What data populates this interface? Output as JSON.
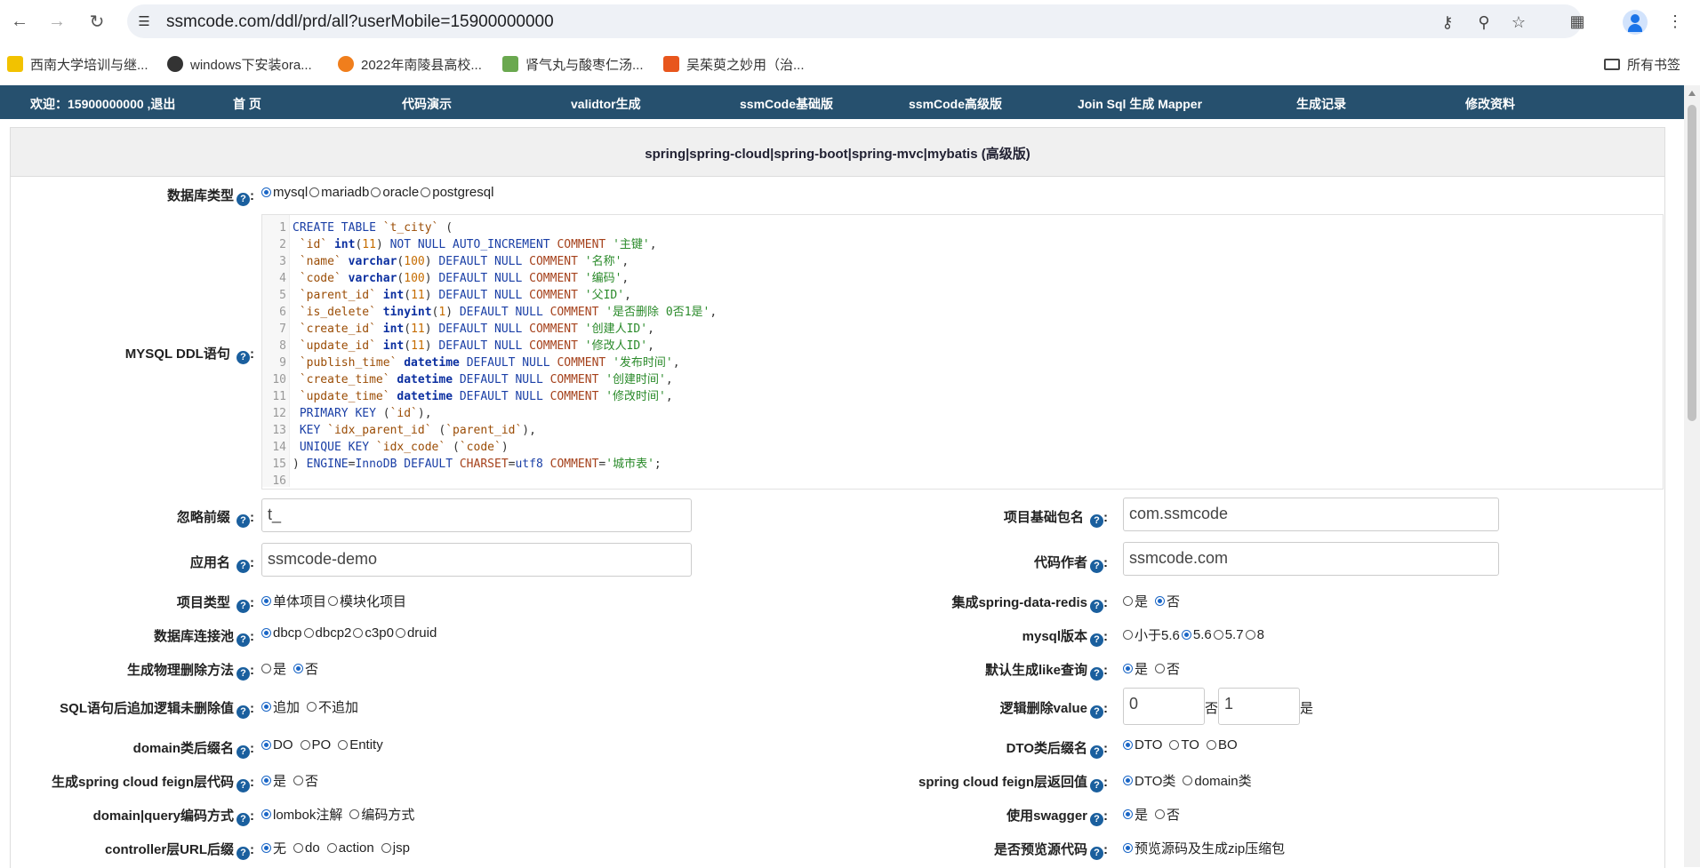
{
  "browser": {
    "url": "ssmcode.com/ddl/prd/all?userMobile=15900000000",
    "bookmarks": [
      {
        "label": "西南大学培训与继...",
        "color": "#f2c200"
      },
      {
        "label": "windows下安装ora...",
        "color": "#333333"
      },
      {
        "label": "2022年南陵县高校...",
        "color": "#f07e1c"
      },
      {
        "label": "肾气丸与酸枣仁汤...",
        "color": "#6aa84f"
      },
      {
        "label": "吴茱萸之妙用（治...",
        "color": "#e8561d"
      }
    ],
    "all_bookmarks": "所有书签"
  },
  "nav": {
    "welcome": "欢迎：15900000000 ,退出",
    "items": [
      "首 页",
      "代码演示",
      "validtor生成",
      "ssmCode基础版",
      "ssmCode高级版",
      "Join Sql 生成 Mapper",
      "生成记录",
      "修改资料"
    ]
  },
  "panel": {
    "title": "spring|spring-cloud|spring-boot|spring-mvc|mybatis (高级版)"
  },
  "form": {
    "db_type": {
      "label": "数据库类型",
      "options": [
        "mysql",
        "mariadb",
        "oracle",
        "postgresql"
      ],
      "selected": "mysql"
    },
    "ddl": {
      "label": "MYSQL DDL语句 ",
      "lines": [
        "CREATE TABLE `t_city` (",
        " `id` int(11) NOT NULL AUTO_INCREMENT COMMENT '主键',",
        " `name` varchar(100) DEFAULT NULL COMMENT '名称',",
        " `code` varchar(100) DEFAULT NULL COMMENT '编码',",
        " `parent_id` int(11) DEFAULT NULL COMMENT '父ID',",
        " `is_delete` tinyint(1) DEFAULT NULL COMMENT '是否删除 0否1是',",
        " `create_id` int(11) DEFAULT NULL COMMENT '创建人ID',",
        " `update_id` int(11) DEFAULT NULL COMMENT '修改人ID',",
        " `publish_time` datetime DEFAULT NULL COMMENT '发布时间',",
        " `create_time` datetime DEFAULT NULL COMMENT '创建时间',",
        " `update_time` datetime DEFAULT NULL COMMENT '修改时间',",
        " PRIMARY KEY (`id`),",
        " KEY `idx_parent_id` (`parent_id`),",
        " UNIQUE KEY `idx_code` (`code`)",
        ") ENGINE=InnoDB DEFAULT CHARSET=utf8 COMMENT='城市表';",
        ""
      ]
    },
    "ignore_prefix": {
      "label": "忽略前缀 ",
      "value": "t_"
    },
    "base_package": {
      "label": "项目基础包名 ",
      "value": "com.ssmcode"
    },
    "app_name": {
      "label": "应用名 ",
      "value": "ssmcode-demo"
    },
    "author": {
      "label": "代码作者",
      "value": "ssmcode.com"
    },
    "project_type": {
      "label": "项目类型 ",
      "options": [
        "单体项目",
        "模块化项目"
      ],
      "selected": "单体项目"
    },
    "redis": {
      "label": "集成spring-data-redis",
      "options": [
        "是",
        "否"
      ],
      "selected": "否"
    },
    "pool": {
      "label": "数据库连接池",
      "options": [
        "dbcp",
        "dbcp2",
        "c3p0",
        "druid"
      ],
      "selected": "dbcp"
    },
    "mysql_version": {
      "label": "mysql版本",
      "options": [
        "小于5.6",
        "5.6",
        "5.7",
        "8"
      ],
      "selected": "5.6"
    },
    "physical_delete": {
      "label": "生成物理删除方法",
      "options": [
        "是",
        "否"
      ],
      "selected": "否"
    },
    "like_query": {
      "label": "默认生成like查询",
      "options": [
        "是",
        "否"
      ],
      "selected": "是"
    },
    "sql_logic": {
      "label": "SQL语句后追加逻辑未删除值",
      "options": [
        "追加",
        "不追加"
      ],
      "selected": "追加"
    },
    "logic_value": {
      "label": "逻辑删除value",
      "no_value": "0",
      "no_label": "否",
      "yes_value": "1",
      "yes_label": "是"
    },
    "domain_suffix": {
      "label": "domain类后缀名",
      "options": [
        "DO",
        "PO",
        "Entity"
      ],
      "selected": "DO"
    },
    "dto_suffix": {
      "label": "DTO类后缀名",
      "options": [
        "DTO",
        "TO",
        "BO"
      ],
      "selected": "DTO"
    },
    "feign": {
      "label": "生成spring cloud feign层代码",
      "options": [
        "是",
        "否"
      ],
      "selected": "是"
    },
    "feign_return": {
      "label": "spring cloud feign层返回值",
      "options": [
        "DTO类",
        "domain类"
      ],
      "selected": "DTO类"
    },
    "encoding": {
      "label": "domain|query编码方式",
      "options": [
        "lombok注解",
        "编码方式"
      ],
      "selected": "lombok注解"
    },
    "swagger": {
      "label": "使用swagger",
      "options": [
        "是",
        "否"
      ],
      "selected": "是"
    },
    "url_suffix": {
      "label": "controller层URL后缀",
      "options": [
        "无",
        "do",
        "action",
        "jsp"
      ],
      "selected": "无"
    },
    "preview": {
      "label": "是否预览源代码",
      "options": [
        "预览源码及生成zip压缩包"
      ],
      "selected": "预览源码及生成zip压缩包"
    }
  }
}
